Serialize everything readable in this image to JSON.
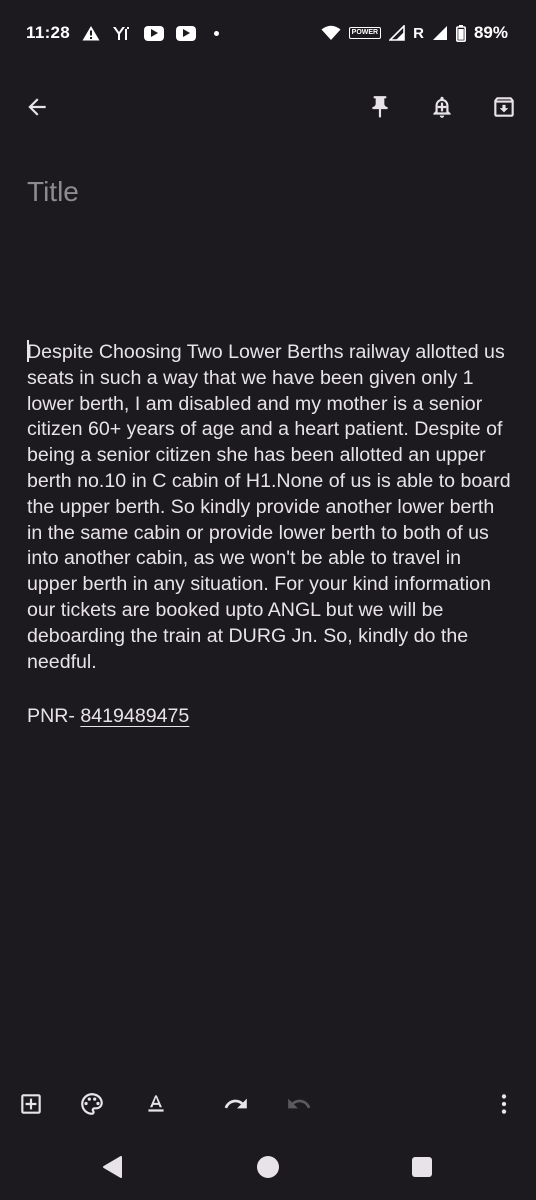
{
  "status_bar": {
    "time": "11:28",
    "network_type": "R",
    "battery_percent": "89%",
    "vpn_badge": "POWER",
    "icons": [
      "alert-icon",
      "app-notification-icon",
      "youtube-icon",
      "youtube-icon",
      "more-notifications-dot",
      "wifi-icon",
      "vpn-icon",
      "signal-roaming-icon",
      "signal-icon",
      "battery-icon"
    ]
  },
  "app_bar": {
    "icons": [
      "back-arrow-icon",
      "pin-icon",
      "reminder-bell-icon",
      "archive-icon"
    ]
  },
  "note": {
    "title_placeholder": "Title",
    "body": "Despite Choosing Two Lower Berths railway allotted us seats in such a way that we have been given only 1 lower berth, I am disabled and my mother is a senior citizen 60+ years of age and a heart patient. Despite of being a senior citizen she has been allotted an upper berth no.10 in C cabin of H1.None of us is able to board the upper berth. So kindly provide another lower berth in the same cabin or provide lower berth to both of us into another cabin, as we won't be able to travel in upper berth in any situation. For your kind information our tickets are booked upto ANGL but we will be deboarding the train at DURG Jn. So, kindly do the needful.",
    "pnr_label": "PNR- ",
    "pnr_number": "8419489475"
  },
  "bottom_toolbar": {
    "icons": [
      "add-box-icon",
      "palette-icon",
      "text-format-icon",
      "undo-icon",
      "redo-icon",
      "more-vert-icon"
    ]
  },
  "nav_bar": {
    "icons": [
      "nav-back-icon",
      "nav-home-icon",
      "nav-recents-icon"
    ]
  },
  "colors": {
    "background": "#1c1a1e",
    "text": "#e7e3e8",
    "placeholder": "#8d8a90",
    "disabled_icon": "#5b585e"
  }
}
